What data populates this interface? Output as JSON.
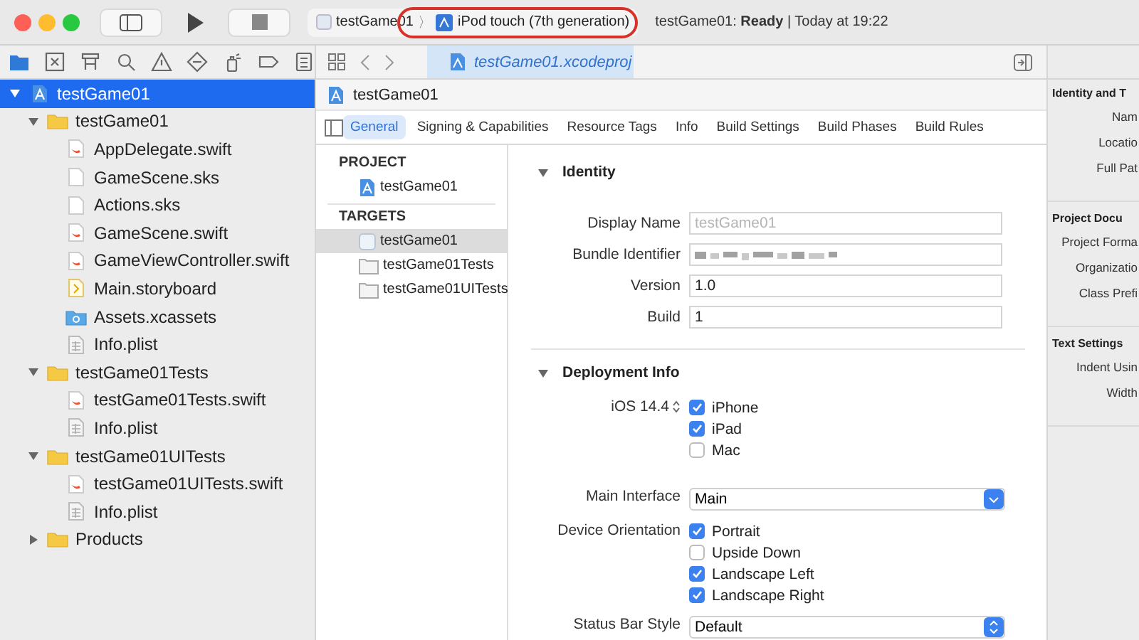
{
  "toolbar": {
    "scheme": "testGame01",
    "separator": "〉",
    "device": "iPod touch (7th generation)",
    "status": "testGame01: **Ready** | Today at 19:22",
    "highlighted": true
  },
  "navigator": {
    "tree": [
      {
        "label": "testGame01",
        "kind": "project",
        "selected": true,
        "expanded": true,
        "children": [
          {
            "label": "testGame01",
            "kind": "folder",
            "selected": false,
            "expanded": true,
            "children": [
              {
                "label": "AppDelegate.swift",
                "kind": "swift",
                "selected": false
              },
              {
                "label": "GameScene.sks",
                "kind": "sks",
                "selected": false
              },
              {
                "label": "Actions.sks",
                "kind": "sks",
                "selected": false
              },
              {
                "label": "GameScene.swift",
                "kind": "swift",
                "selected": false
              },
              {
                "label": "GameViewController.swift",
                "kind": "swift",
                "selected": false
              },
              {
                "label": "Main.storyboard",
                "kind": "storyboard",
                "selected": false
              },
              {
                "label": "Assets.xcassets",
                "kind": "assets",
                "selected": false
              },
              {
                "label": "Info.plist",
                "kind": "plist",
                "selected": false
              }
            ]
          },
          {
            "label": "testGame01Tests",
            "kind": "folder",
            "selected": false,
            "expanded": true,
            "children": [
              {
                "label": "testGame01Tests.swift",
                "kind": "swift",
                "selected": false
              },
              {
                "label": "Info.plist",
                "kind": "plist",
                "selected": false
              }
            ]
          },
          {
            "label": "testGame01UITests",
            "kind": "folder",
            "selected": false,
            "expanded": true,
            "children": [
              {
                "label": "testGame01UITests.swift",
                "kind": "swift",
                "selected": false
              },
              {
                "label": "Info.plist",
                "kind": "plist",
                "selected": false
              }
            ]
          },
          {
            "label": "Products",
            "kind": "folder",
            "selected": false,
            "expanded": false
          }
        ]
      }
    ]
  },
  "editor": {
    "file_tab": "testGame01.xcodeproj",
    "jump_bar": "testGame01",
    "tabs": [
      {
        "label": "General",
        "selected": true
      },
      {
        "label": "Signing & Capabilities",
        "selected": false
      },
      {
        "label": "Resource Tags",
        "selected": false
      },
      {
        "label": "Info",
        "selected": false
      },
      {
        "label": "Build Settings",
        "selected": false
      },
      {
        "label": "Build Phases",
        "selected": false
      },
      {
        "label": "Build Rules",
        "selected": false
      }
    ],
    "project_header": "PROJECT",
    "projects": [
      {
        "label": "testGame01",
        "selected": false
      }
    ],
    "targets_header": "TARGETS",
    "targets": [
      {
        "label": "testGame01",
        "kind": "app",
        "selected": true
      },
      {
        "label": "testGame01Tests",
        "kind": "test",
        "selected": false
      },
      {
        "label": "testGame01UITests",
        "kind": "test",
        "selected": false
      }
    ],
    "identity": {
      "title": "Identity",
      "expanded": true,
      "fields": [
        {
          "label": "Display Name",
          "kind": "text",
          "placeholder": "testGame01"
        },
        {
          "label": "Bundle Identifier",
          "kind": "blurred"
        },
        {
          "label": "Version",
          "kind": "text",
          "value": "1.0"
        },
        {
          "label": "Build",
          "kind": "text",
          "value": "1"
        }
      ]
    },
    "deployment": {
      "title": "Deployment Info",
      "expanded": true,
      "target": "iOS 14.4",
      "devices": [
        {
          "label": "iPhone",
          "checked": true
        },
        {
          "label": "iPad",
          "checked": true
        },
        {
          "label": "Mac",
          "checked": false
        }
      ],
      "main_interface": {
        "label": "Main Interface",
        "value": "Main"
      },
      "orientation": {
        "label": "Device Orientation",
        "options": [
          {
            "label": "Portrait",
            "checked": true
          },
          {
            "label": "Upside Down",
            "checked": false
          },
          {
            "label": "Landscape Left",
            "checked": true
          },
          {
            "label": "Landscape Right",
            "checked": true
          }
        ]
      },
      "status_bar_style": {
        "label": "Status Bar Style",
        "value": "Default"
      }
    }
  },
  "inspector": {
    "sections": [
      {
        "title": "Identity and T",
        "rows": [
          "Nam",
          "Locatio",
          "Full Pat"
        ]
      },
      {
        "title": "Project Docu",
        "rows": [
          "Project Forma",
          "Organizatio",
          "Class Prefi"
        ]
      },
      {
        "title": "Text Settings",
        "rows": [
          "Indent Usin",
          "Width"
        ]
      }
    ]
  }
}
